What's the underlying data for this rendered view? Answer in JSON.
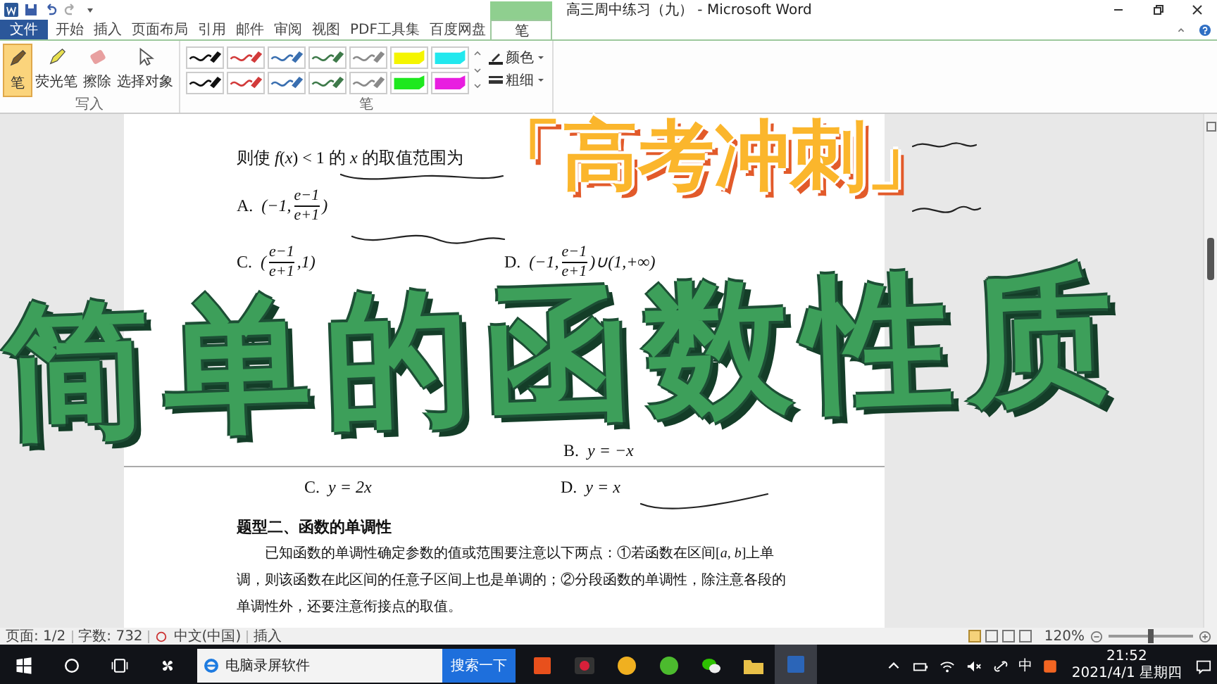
{
  "window": {
    "title": "高三周中练习（九） - Microsoft Word"
  },
  "tabs": [
    {
      "label": "文件",
      "kind": "file",
      "selected": false
    },
    {
      "label": "开始",
      "kind": "plain",
      "selected": false
    },
    {
      "label": "插入",
      "kind": "plain",
      "selected": false
    },
    {
      "label": "页面布局",
      "kind": "plain",
      "selected": false
    },
    {
      "label": "引用",
      "kind": "plain",
      "selected": false
    },
    {
      "label": "邮件",
      "kind": "plain",
      "selected": false
    },
    {
      "label": "审阅",
      "kind": "plain",
      "selected": false
    },
    {
      "label": "视图",
      "kind": "plain",
      "selected": false
    },
    {
      "label": "PDF工具集",
      "kind": "plain",
      "selected": false
    },
    {
      "label": "百度网盘",
      "kind": "plain",
      "selected": false
    },
    {
      "label": "笔",
      "kind": "contextual",
      "selected": true
    }
  ],
  "ribbon": {
    "write_group": {
      "label": "写入",
      "buttons": [
        {
          "label": "笔",
          "kind": "pen",
          "selected": true
        },
        {
          "label": "荧光笔",
          "kind": "highlighter",
          "selected": false
        },
        {
          "label": "擦除",
          "kind": "eraser",
          "selected": false
        },
        {
          "label": "选择对象",
          "kind": "select",
          "selected": false
        }
      ]
    },
    "pen_group": {
      "label": "笔",
      "pens": [
        {
          "kind": "pen",
          "color": "#111111"
        },
        {
          "kind": "pen",
          "color": "#d23a3a"
        },
        {
          "kind": "pen",
          "color": "#3a6fb0"
        },
        {
          "kind": "pen",
          "color": "#3e7a4a"
        },
        {
          "kind": "pen",
          "color": "#8a8a8a"
        },
        {
          "kind": "highlighter",
          "color": "#f5f500"
        },
        {
          "kind": "highlighter",
          "color": "#22e8ee"
        },
        {
          "kind": "pen",
          "color": "#111111"
        },
        {
          "kind": "pen",
          "color": "#d23a3a"
        },
        {
          "kind": "pen",
          "color": "#3a6fb0"
        },
        {
          "kind": "pen",
          "color": "#3e7a4a"
        },
        {
          "kind": "pen",
          "color": "#8a8a8a"
        },
        {
          "kind": "highlighter",
          "color": "#1ee81e"
        },
        {
          "kind": "highlighter",
          "color": "#e81ee0"
        }
      ],
      "options": [
        {
          "label": "颜色",
          "kind": "color"
        },
        {
          "label": "粗细",
          "kind": "weight"
        }
      ]
    }
  },
  "document": {
    "page1": [
      {
        "kind": "sentence",
        "text": "则使 *f*(*x*) < 1 的 *x* 的取值范围为"
      },
      {
        "kind": "choices",
        "items": [
          {
            "label": "A.",
            "math": [
              {
                "kind": "text",
                "text": "(−1,"
              },
              {
                "kind": "frac",
                "num": "e−1",
                "den": "e+1"
              },
              {
                "kind": "text",
                "text": ")"
              }
            ]
          }
        ]
      },
      {
        "kind": "choices",
        "items": [
          {
            "label": "C.",
            "math": [
              {
                "kind": "text",
                "text": "("
              },
              {
                "kind": "frac",
                "num": "e−1",
                "den": "e+1"
              },
              {
                "kind": "text",
                "text": ",1)"
              }
            ]
          },
          {
            "label": "D.",
            "math": [
              {
                "kind": "text",
                "text": "(−1,"
              },
              {
                "kind": "frac",
                "num": "e−1",
                "den": "e+1"
              },
              {
                "kind": "text",
                "text": ")∪(1,+∞)"
              }
            ]
          }
        ]
      },
      {
        "kind": "late_choices",
        "items": [
          {
            "label": "B.",
            "math": [
              {
                "kind": "text",
                "text": "y = −x"
              }
            ]
          }
        ]
      }
    ],
    "page2": [
      {
        "kind": "subchoices",
        "items": [
          {
            "label": "C.",
            "math": [
              {
                "kind": "text",
                "text": "y = 2x"
              }
            ]
          },
          {
            "label": "D.",
            "math": [
              {
                "kind": "text",
                "text": "y = x"
              }
            ]
          }
        ]
      },
      {
        "kind": "heading",
        "text": "题型二、函数的单调性"
      },
      {
        "kind": "paragraph",
        "text": "已知函数的单调性确定参数的值或范围要注意以下两点：①若函数在区间[*a*, *b*]上单调，则该函数在此区间的任意子区间上也是单调的；②分段函数的单调性，除注意各段的单调性外，还要注意衔接点的取值。"
      }
    ]
  },
  "overlay": {
    "subtitle": "「高考冲刺」",
    "title": "简单的函数性质"
  },
  "status_bar": {
    "page": "页面: 1/2",
    "words": "字数: 732",
    "language": "中文(中国)",
    "mode": "插入",
    "zoom": "120%",
    "zoom_slider": {
      "level": 0.5
    }
  },
  "taskbar": {
    "search_text": "电脑录屏软件",
    "search_button": "搜索一下",
    "apps": [
      {
        "kind": "office",
        "selected": false
      },
      {
        "kind": "record",
        "selected": false
      },
      {
        "kind": "browser",
        "selected": false
      },
      {
        "kind": "shield",
        "selected": false
      },
      {
        "kind": "chat",
        "selected": false
      },
      {
        "kind": "folder",
        "selected": false
      },
      {
        "kind": "word",
        "selected": true
      }
    ],
    "ime": "中",
    "time": "21:52",
    "date": "2021/4/1 星期四"
  }
}
